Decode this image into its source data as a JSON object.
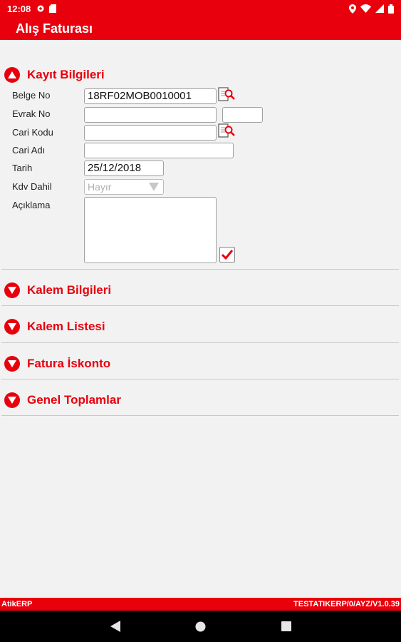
{
  "status_bar": {
    "time": "12:08",
    "left_icons": [
      "gear-icon",
      "sd-card-icon"
    ],
    "right_icons": [
      "location-icon",
      "wifi-icon",
      "signal-icon",
      "battery-icon"
    ]
  },
  "app_bar": {
    "title": "Alış Faturası"
  },
  "sections": {
    "kayit": {
      "title": "Kayıt Bilgileri",
      "expanded": true
    },
    "kalem_bilgileri": {
      "title": "Kalem Bilgileri",
      "expanded": false
    },
    "kalem_listesi": {
      "title": "Kalem Listesi",
      "expanded": false
    },
    "fatura_iskonto": {
      "title": "Fatura İskonto",
      "expanded": false
    },
    "genel_toplamlar": {
      "title": "Genel Toplamlar",
      "expanded": false
    }
  },
  "form": {
    "belge_no": {
      "label": "Belge No",
      "value": "18RF02MOB0010001"
    },
    "evrak_no": {
      "label": "Evrak No",
      "value": "",
      "value2": ""
    },
    "cari_kodu": {
      "label": "Cari Kodu",
      "value": ""
    },
    "cari_adi": {
      "label": "Cari Adı",
      "value": ""
    },
    "tarih": {
      "label": "Tarih",
      "value": "25/12/2018"
    },
    "kdv_dahil": {
      "label": "Kdv Dahil",
      "value": "Hayır"
    },
    "aciklama": {
      "label": "Açıklama",
      "value": ""
    }
  },
  "footer": {
    "left": "AtikERP",
    "right": "TESTATIKERP/0/AYZ/V1.0.39"
  },
  "colors": {
    "accent": "#e8000d"
  }
}
